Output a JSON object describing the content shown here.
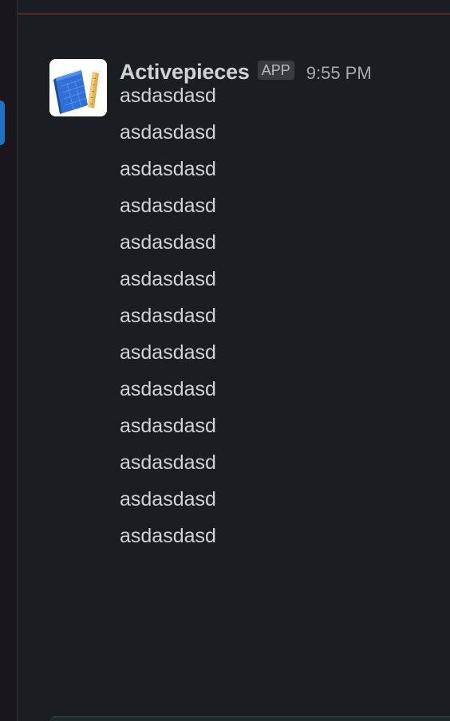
{
  "message": {
    "sender": "Activepieces",
    "badge": "APP",
    "time": "9:55 PM",
    "avatar_icon": "blueprint-notebook-icon",
    "lines": [
      "asdasdasd",
      "asdasdasd",
      "asdasdasd",
      "asdasdasd",
      "asdasdasd",
      "asdasdasd",
      "asdasdasd",
      "asdasdasd",
      "asdasdasd",
      "asdasdasd",
      "asdasdasd",
      "asdasdasd",
      "asdasdasd"
    ]
  },
  "colors": {
    "background": "#1a1d21",
    "text": "#d1d2d3",
    "accent": "#1d74c7",
    "divider": "#8a3a2e"
  }
}
